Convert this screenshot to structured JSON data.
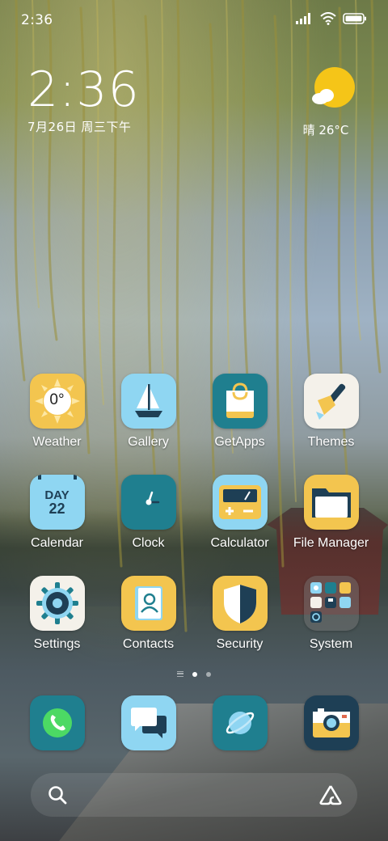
{
  "status_bar": {
    "time": "2:36",
    "icons": [
      "signal-icon",
      "wifi-icon",
      "battery-icon"
    ]
  },
  "clock_widget": {
    "time": "2:36",
    "date": "7月26日 周三下午"
  },
  "weather_widget": {
    "icon": "partly-sunny-icon",
    "text": "晴 26°C"
  },
  "apps": [
    {
      "label": "Weather",
      "icon": "weather-sun-icon",
      "bg": "#f3c54f"
    },
    {
      "label": "Gallery",
      "icon": "sailboat-icon",
      "bg": "#8fd6f2"
    },
    {
      "label": "GetApps",
      "icon": "shopping-bag-icon",
      "bg": "#1f7f8f"
    },
    {
      "label": "Themes",
      "icon": "paintbrush-icon",
      "bg": "#f4f1ea"
    },
    {
      "label": "Calendar",
      "icon": "calendar-icon",
      "bg": "#8fd6f2"
    },
    {
      "label": "Clock",
      "icon": "clock-icon",
      "bg": "#1f7f8f"
    },
    {
      "label": "Calculator",
      "icon": "calculator-icon",
      "bg": "#8fd6f2"
    },
    {
      "label": "File Manager",
      "icon": "folder-icon",
      "bg": "#f3c54f"
    },
    {
      "label": "Settings",
      "icon": "gear-icon",
      "bg": "#f4f1ea"
    },
    {
      "label": "Contacts",
      "icon": "contacts-book-icon",
      "bg": "#f3c54f"
    },
    {
      "label": "Security",
      "icon": "shield-icon",
      "bg": "#f3c54f"
    },
    {
      "label": "System",
      "icon": "app-folder-icon",
      "bg": "rgba(120,120,120,0.45)"
    }
  ],
  "weather_icon_text": "0°",
  "calendar_icon_text": {
    "day_label": "DAY",
    "day_number": "22"
  },
  "page_indicator": {
    "pages": 2,
    "current": 1
  },
  "dock": [
    {
      "icon": "phone-icon",
      "bg": "#1f7f8f"
    },
    {
      "icon": "messages-icon",
      "bg": "#8fd6f2"
    },
    {
      "icon": "browser-icon",
      "bg": "#1f7f8f"
    },
    {
      "icon": "camera-icon",
      "bg": "#1e3f55"
    }
  ],
  "search_bar": {
    "left_icon": "search-icon",
    "right_icon": "assistant-icon"
  },
  "colors": {
    "accent_yellow": "#f3c54f",
    "accent_blue": "#8fd6f2",
    "accent_teal": "#1f7f8f",
    "dark_navy": "#1e3f55"
  }
}
